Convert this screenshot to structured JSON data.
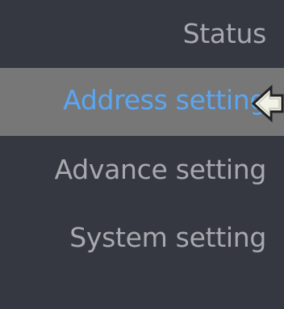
{
  "menu": {
    "items": [
      {
        "label": "Status",
        "selected": false
      },
      {
        "label": "Address setting",
        "selected": true
      },
      {
        "label": "Advance setting",
        "selected": false
      },
      {
        "label": "System setting",
        "selected": false
      }
    ]
  },
  "colors": {
    "background": "#353841",
    "selected_background": "#777777",
    "text": "#a7a9ae",
    "selected_text": "#5ba6f2"
  },
  "icons": {
    "selection_pointer": "arrow-left-icon"
  }
}
